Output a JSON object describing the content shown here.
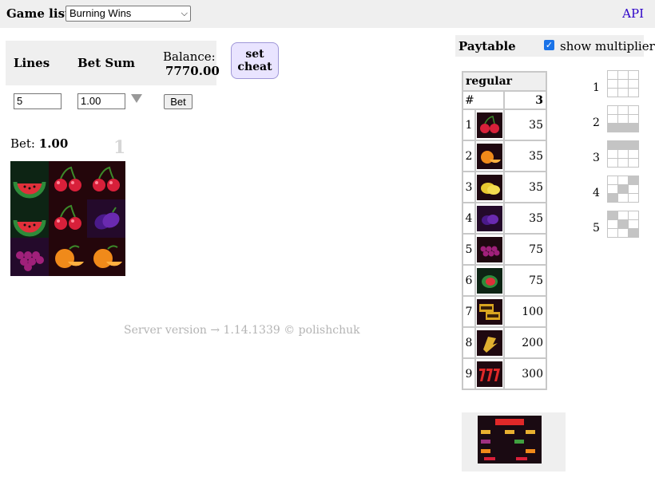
{
  "topbar": {
    "game_list_label": "Game list:",
    "selected_game": "Burning Wins",
    "api_link": "API"
  },
  "controls": {
    "lines_label": "Lines",
    "bet_sum_label": "Bet Sum",
    "balance_label": "Balance:",
    "balance_value": "7770.00",
    "cheat_label_1": "set",
    "cheat_label_2": "cheat",
    "lines_value": "5",
    "bet_sum_value": "1.00",
    "bet_button": "Bet"
  },
  "result": {
    "bet_label": "Bet:",
    "bet_value": "1.00",
    "round_number": "1",
    "reels": [
      [
        "watermelon",
        "cherry",
        "cherry"
      ],
      [
        "watermelon",
        "cherry",
        "plum"
      ],
      [
        "grapes",
        "orange",
        "orange"
      ]
    ]
  },
  "footer": {
    "server_version": "Server version → 1.14.1339   ©   polishchuk"
  },
  "paytable": {
    "title": "Paytable",
    "show_multiplier_label": "show multiplier",
    "show_multiplier_checked": true,
    "section": "regular",
    "hash_header": "#",
    "count_header": "3",
    "rows": [
      {
        "n": "1",
        "symbol": "cherry-icon",
        "value": "35"
      },
      {
        "n": "2",
        "symbol": "orange-icon",
        "value": "35"
      },
      {
        "n": "3",
        "symbol": "lemon-icon",
        "value": "35"
      },
      {
        "n": "4",
        "symbol": "plum-icon",
        "value": "35"
      },
      {
        "n": "5",
        "symbol": "grapes-icon",
        "value": "75"
      },
      {
        "n": "6",
        "symbol": "watermelon-icon",
        "value": "75"
      },
      {
        "n": "7",
        "symbol": "bar-icon",
        "value": "100"
      },
      {
        "n": "8",
        "symbol": "bell-icon",
        "value": "200"
      },
      {
        "n": "9",
        "symbol": "seven-icon",
        "value": "300"
      }
    ]
  },
  "lines": [
    {
      "n": "1",
      "pattern": [
        0,
        0,
        0,
        0,
        0,
        0,
        0,
        0,
        0
      ]
    },
    {
      "n": "2",
      "pattern": [
        0,
        0,
        0,
        0,
        0,
        0,
        1,
        1,
        1
      ]
    },
    {
      "n": "3",
      "pattern": [
        1,
        1,
        1,
        0,
        0,
        0,
        0,
        0,
        0
      ]
    },
    {
      "n": "4",
      "pattern": [
        0,
        0,
        1,
        0,
        1,
        0,
        1,
        0,
        0
      ]
    },
    {
      "n": "5",
      "pattern": [
        1,
        0,
        0,
        0,
        1,
        0,
        0,
        0,
        1
      ]
    }
  ],
  "colors": {
    "api_link": "#2b00c8",
    "panel_bg": "#efefef",
    "cheat_bg": "#e9e4ff",
    "checkbox": "#1a73e8"
  }
}
